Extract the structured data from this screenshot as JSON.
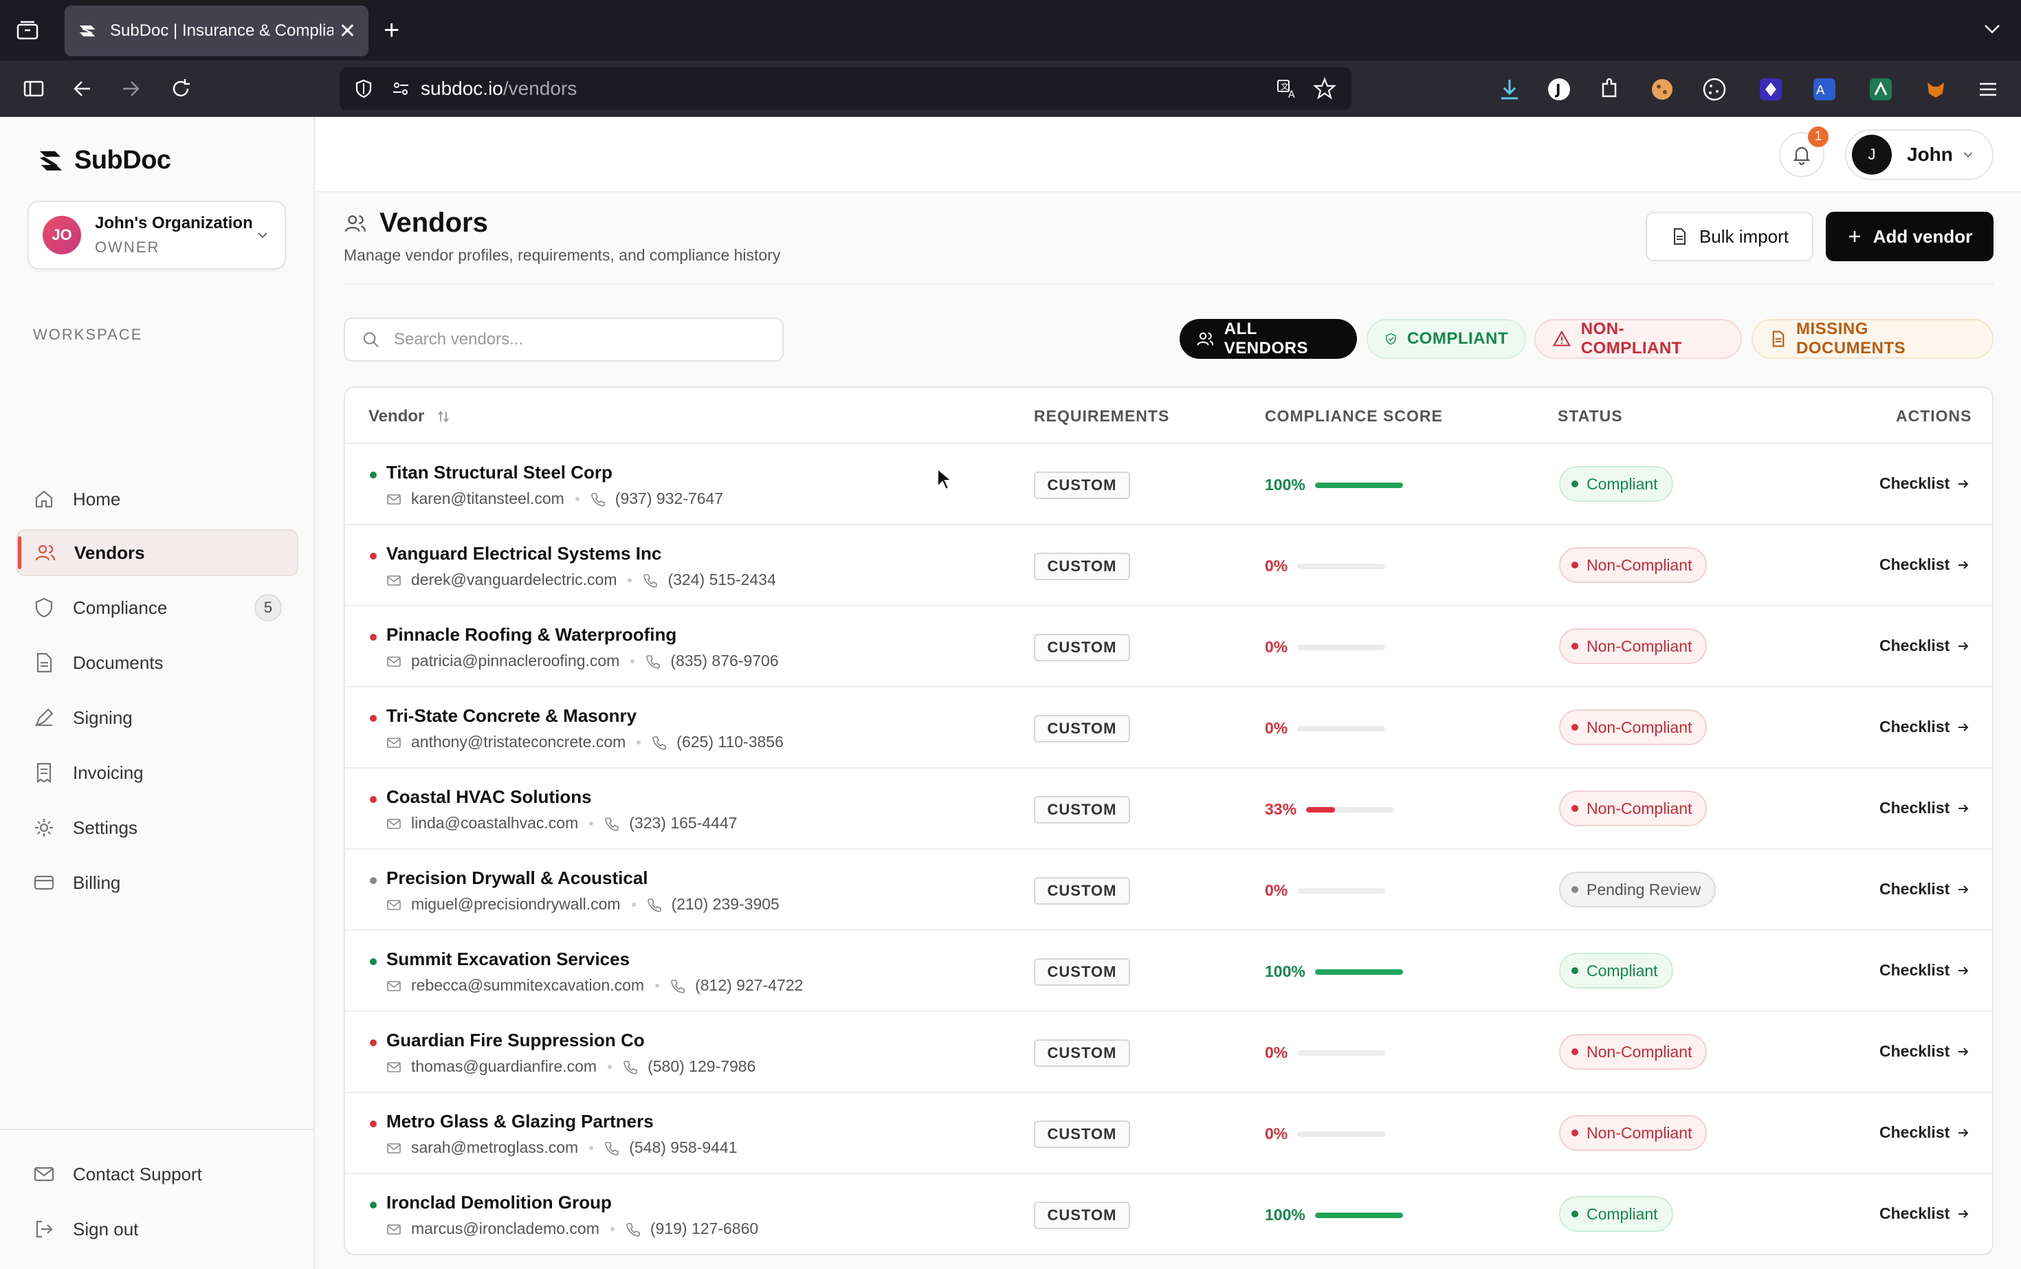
{
  "browser": {
    "tab_title": "SubDoc | Insurance & Compliance",
    "url_host": "subdoc.io",
    "url_path": "/vendors"
  },
  "sidebar": {
    "brand": "SubDoc",
    "org": {
      "initials": "JO",
      "name": "John's Organization",
      "role": "OWNER"
    },
    "section_label": "WORKSPACE",
    "items": [
      {
        "label": "Home",
        "icon": "home-icon"
      },
      {
        "label": "Vendors",
        "icon": "users-icon",
        "active": true
      },
      {
        "label": "Compliance",
        "icon": "shield-icon",
        "badge": "5"
      },
      {
        "label": "Documents",
        "icon": "document-icon"
      },
      {
        "label": "Signing",
        "icon": "pen-icon"
      },
      {
        "label": "Invoicing",
        "icon": "invoice-icon"
      },
      {
        "label": "Settings",
        "icon": "gear-icon"
      },
      {
        "label": "Billing",
        "icon": "card-icon"
      }
    ],
    "footer": [
      {
        "label": "Contact Support",
        "icon": "mail-icon"
      },
      {
        "label": "Sign out",
        "icon": "signout-icon"
      }
    ]
  },
  "header": {
    "notification_count": "1",
    "user_initial": "J",
    "user_name": "John"
  },
  "page": {
    "title": "Vendors",
    "subtitle": "Manage vendor profiles, requirements, and compliance history",
    "bulk_import_label": "Bulk import",
    "add_vendor_label": "Add vendor",
    "search_placeholder": "Search vendors...",
    "filters": {
      "all": "ALL VENDORS",
      "compliant": "COMPLIANT",
      "non_compliant": "NON-COMPLIANT",
      "missing": "MISSING DOCUMENTS"
    }
  },
  "table": {
    "columns": {
      "vendor": "Vendor",
      "requirements": "REQUIREMENTS",
      "score": "COMPLIANCE SCORE",
      "status": "STATUS",
      "actions": "ACTIONS"
    },
    "rows": [
      {
        "name": "Titan Structural Steel Corp",
        "email": "karen@titansteel.com",
        "phone": "(937) 932-7647",
        "requirement": "CUSTOM",
        "score": "100%",
        "score_value": 100,
        "status": "Compliant",
        "status_kind": "compliant",
        "action": "Checklist"
      },
      {
        "name": "Vanguard Electrical Systems Inc",
        "email": "derek@vanguardelectric.com",
        "phone": "(324) 515-2434",
        "requirement": "CUSTOM",
        "score": "0%",
        "score_value": 0,
        "status": "Non-Compliant",
        "status_kind": "non",
        "action": "Checklist"
      },
      {
        "name": "Pinnacle Roofing & Waterproofing",
        "email": "patricia@pinnacleroofing.com",
        "phone": "(835) 876-9706",
        "requirement": "CUSTOM",
        "score": "0%",
        "score_value": 0,
        "status": "Non-Compliant",
        "status_kind": "non",
        "action": "Checklist"
      },
      {
        "name": "Tri-State Concrete & Masonry",
        "email": "anthony@tristateconcrete.com",
        "phone": "(625) 110-3856",
        "requirement": "CUSTOM",
        "score": "0%",
        "score_value": 0,
        "status": "Non-Compliant",
        "status_kind": "non",
        "action": "Checklist"
      },
      {
        "name": "Coastal HVAC Solutions",
        "email": "linda@coastalhvac.com",
        "phone": "(323) 165-4447",
        "requirement": "CUSTOM",
        "score": "33%",
        "score_value": 33,
        "status": "Non-Compliant",
        "status_kind": "non",
        "action": "Checklist"
      },
      {
        "name": "Precision Drywall & Acoustical",
        "email": "miguel@precisiondrywall.com",
        "phone": "(210) 239-3905",
        "requirement": "CUSTOM",
        "score": "0%",
        "score_value": 0,
        "status": "Pending Review",
        "status_kind": "pending",
        "action": "Checklist"
      },
      {
        "name": "Summit Excavation Services",
        "email": "rebecca@summitexcavation.com",
        "phone": "(812) 927-4722",
        "requirement": "CUSTOM",
        "score": "100%",
        "score_value": 100,
        "status": "Compliant",
        "status_kind": "compliant",
        "action": "Checklist"
      },
      {
        "name": "Guardian Fire Suppression Co",
        "email": "thomas@guardianfire.com",
        "phone": "(580) 129-7986",
        "requirement": "CUSTOM",
        "score": "0%",
        "score_value": 0,
        "status": "Non-Compliant",
        "status_kind": "non",
        "action": "Checklist"
      },
      {
        "name": "Metro Glass & Glazing Partners",
        "email": "sarah@metroglass.com",
        "phone": "(548) 958-9441",
        "requirement": "CUSTOM",
        "score": "0%",
        "score_value": 0,
        "status": "Non-Compliant",
        "status_kind": "non",
        "action": "Checklist"
      },
      {
        "name": "Ironclad Demolition Group",
        "email": "marcus@ironclademo.com",
        "phone": "(919) 127-6860",
        "requirement": "CUSTOM",
        "score": "100%",
        "score_value": 100,
        "status": "Compliant",
        "status_kind": "compliant",
        "action": "Checklist"
      }
    ]
  },
  "colors": {
    "compliant": "#16884c",
    "non_compliant": "#d9303d",
    "pending": "#888888",
    "accent": "#e0533d"
  }
}
